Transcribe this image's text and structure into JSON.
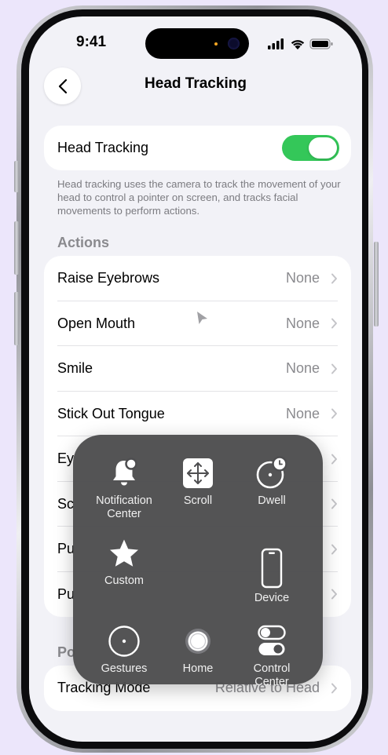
{
  "status_bar": {
    "time": "9:41"
  },
  "nav": {
    "title": "Head Tracking"
  },
  "main_toggle": {
    "label": "Head Tracking",
    "on": true
  },
  "description": "Head tracking uses the camera to track the movement of your head to control a pointer on screen, and tracks facial movements to perform actions.",
  "actions_section": {
    "header": "Actions",
    "rows": [
      {
        "label": "Raise Eyebrows",
        "value": "None"
      },
      {
        "label": "Open Mouth",
        "value": "None"
      },
      {
        "label": "Smile",
        "value": "None"
      },
      {
        "label": "Stick Out Tongue",
        "value": "None"
      },
      {
        "label": "Ey",
        "value": ""
      },
      {
        "label": "Sc",
        "value": ""
      },
      {
        "label": "Pu",
        "value": ""
      },
      {
        "label": "Pu",
        "value": ""
      }
    ]
  },
  "pointer_section": {
    "header": "Po",
    "rows": [
      {
        "label": "Tracking Mode",
        "value": "Relative to Head"
      }
    ]
  },
  "assistive_menu": {
    "items": [
      {
        "id": "notification-center",
        "label": "Notification Center",
        "icon": "bell-icon"
      },
      {
        "id": "scroll",
        "label": "Scroll",
        "icon": "scroll-arrows-icon"
      },
      {
        "id": "dwell",
        "label": "Dwell",
        "icon": "dwell-timer-icon"
      },
      {
        "id": "custom",
        "label": "Custom",
        "icon": "star-icon"
      },
      {
        "id": "device",
        "label": "Device",
        "icon": "iphone-icon"
      },
      {
        "id": "gestures",
        "label": "Gestures",
        "icon": "gesture-circle-icon"
      },
      {
        "id": "home",
        "label": "Home",
        "icon": "home-button-icon"
      },
      {
        "id": "control-center",
        "label": "Control Center",
        "icon": "control-center-toggles-icon"
      }
    ]
  },
  "colors": {
    "accent_green": "#34c759",
    "background": "#f2f2f7",
    "menu_bg": "#4e4e50"
  }
}
